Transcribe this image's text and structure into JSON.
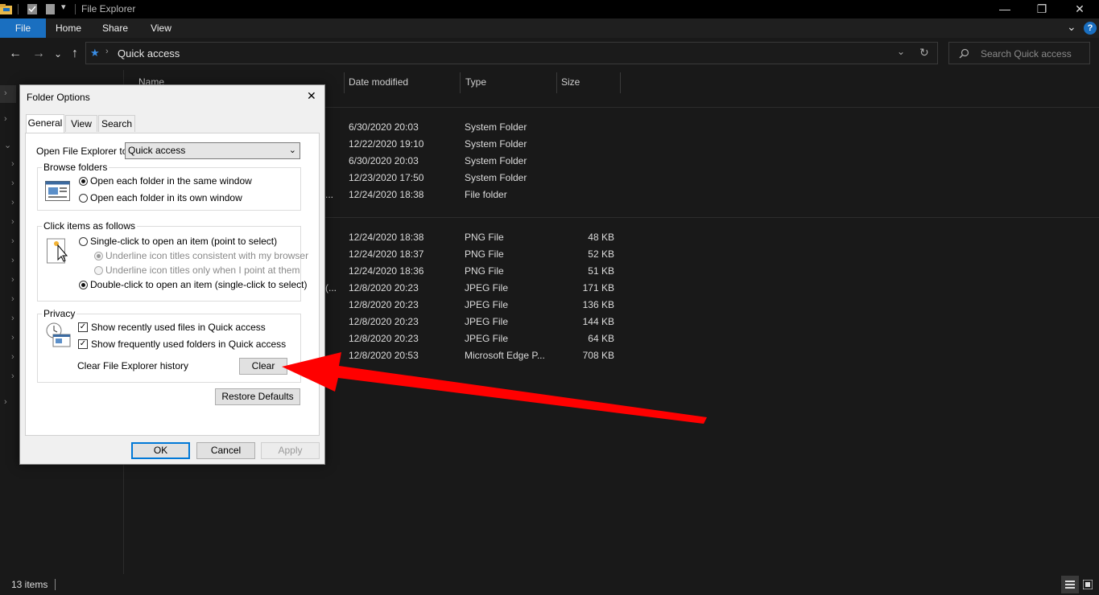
{
  "window": {
    "title": "File Explorer",
    "controls": {
      "minimize": "—",
      "restore": "❐",
      "close": "✕"
    }
  },
  "ribbon": {
    "tabs": [
      "File",
      "Home",
      "Share",
      "View"
    ],
    "help": "?",
    "expand": "⌄"
  },
  "nav": {
    "back": "←",
    "forward": "→",
    "recent": "⌄",
    "up": "↑",
    "location": "Quick access",
    "search_placeholder": "Search Quick access",
    "refresh": "↻",
    "dropdown": "⌄"
  },
  "columns": [
    "Name",
    "Date modified",
    "Type",
    "Size"
  ],
  "rows": [
    {
      "date": "6/30/2020 20:03",
      "type": "System Folder",
      "size": ""
    },
    {
      "date": "12/22/2020 19:10",
      "type": "System Folder",
      "size": ""
    },
    {
      "date": "6/30/2020 20:03",
      "type": "System Folder",
      "size": ""
    },
    {
      "date": "12/23/2020 17:50",
      "type": "System Folder",
      "size": ""
    },
    {
      "date": "12/24/2020 18:38",
      "type": "File folder",
      "size": "",
      "trail": "..."
    },
    {
      "date": "12/24/2020 18:38",
      "type": "PNG File",
      "size": "48 KB"
    },
    {
      "date": "12/24/2020 18:37",
      "type": "PNG File",
      "size": "52 KB"
    },
    {
      "date": "12/24/2020 18:36",
      "type": "PNG File",
      "size": "51 KB"
    },
    {
      "date": "12/8/2020 20:23",
      "type": "JPEG File",
      "size": "171 KB",
      "trail": "(..."
    },
    {
      "date": "12/8/2020 20:23",
      "type": "JPEG File",
      "size": "136 KB"
    },
    {
      "date": "12/8/2020 20:23",
      "type": "JPEG File",
      "size": "144 KB"
    },
    {
      "date": "12/8/2020 20:23",
      "type": "JPEG File",
      "size": "64 KB"
    },
    {
      "date": "12/8/2020 20:53",
      "type": "Microsoft Edge P...",
      "size": "708 KB"
    }
  ],
  "status": {
    "items": "13 items"
  },
  "dialog": {
    "title": "Folder Options",
    "close": "✕",
    "tabs": [
      "General",
      "View",
      "Search"
    ],
    "open_to_label": "Open File Explorer to:",
    "open_to_value": "Quick access",
    "browse": {
      "legend": "Browse folders",
      "same_window": "Open each folder in the same window",
      "own_window": "Open each folder in its own window",
      "selected": "same_window"
    },
    "click": {
      "legend": "Click items as follows",
      "single": "Single-click to open an item (point to select)",
      "underline_browser": "Underline icon titles consistent with my browser",
      "underline_point": "Underline icon titles only when I point at them",
      "double": "Double-click to open an item (single-click to select)",
      "selected": "double"
    },
    "privacy": {
      "legend": "Privacy",
      "recent_files": "Show recently used files in Quick access",
      "frequent_folders": "Show frequently used folders in Quick access",
      "clear_label": "Clear File Explorer history",
      "clear_button": "Clear",
      "recent_checked": true,
      "frequent_checked": true
    },
    "restore_defaults": "Restore Defaults",
    "ok": "OK",
    "cancel": "Cancel",
    "apply": "Apply"
  },
  "annotation": {
    "arrow_color": "#ff0000"
  }
}
